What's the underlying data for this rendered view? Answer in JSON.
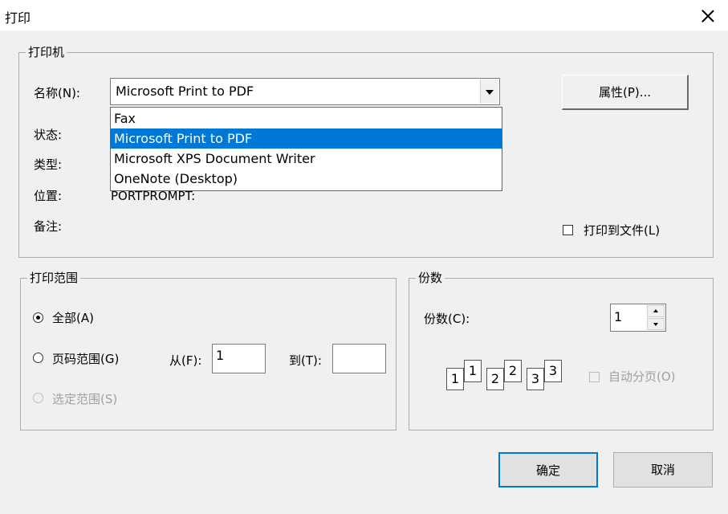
{
  "window": {
    "title": "打印"
  },
  "printer_group": {
    "title": "打印机",
    "name_label": "名称(N):",
    "selected": "Microsoft Print to PDF",
    "options": [
      "Fax",
      "Microsoft Print to PDF",
      "Microsoft XPS Document Writer",
      "OneNote (Desktop)"
    ],
    "status_label": "状态:",
    "type_label": "类型:",
    "location_label": "位置:",
    "location_value": "PORTPROMPT:",
    "comment_label": "备注:",
    "properties_button": "属性(P)...",
    "print_to_file": "打印到文件(L)"
  },
  "range_group": {
    "title": "打印范围",
    "all": "全部(A)",
    "pages": "页码范围(G)",
    "from_label": "从(F):",
    "from_value": "1",
    "to_label": "到(T):",
    "to_value": "",
    "selection": "选定范围(S)"
  },
  "copies_group": {
    "title": "份数",
    "copies_label": "份数(C):",
    "copies_value": "1",
    "collate": "自动分页(O)",
    "collate_icon_digits": [
      "1",
      "1",
      "2",
      "2",
      "3",
      "3"
    ]
  },
  "buttons": {
    "ok": "确定",
    "cancel": "取消"
  }
}
